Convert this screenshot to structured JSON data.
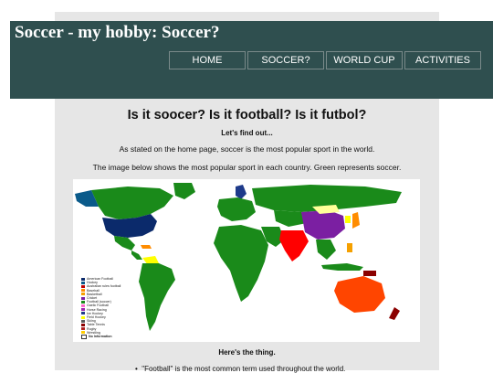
{
  "header": {
    "title": "Soccer - my hobby: Soccer?",
    "nav": [
      "HOME",
      "SOCCER?",
      "WORLD CUP",
      "ACTIVITIES"
    ]
  },
  "main": {
    "heading": "Is it soocer? Is it football? Is it futbol?",
    "subheading": "Let's find out...",
    "paragraph1": "As stated on the home page, soccer is the most popular sport in the world.",
    "paragraph2": "The image below shows the most popular sport in each country. Green represents soccer.",
    "subheading2": "Here's the thing.",
    "bullet1": "\"Football\" is the most common term used throughout the world."
  },
  "map": {
    "legend": [
      {
        "label": "American Football",
        "color": "#0b2a6b"
      },
      {
        "label": "Hockey",
        "color": "#0a5a8a"
      },
      {
        "label": "Australian rules football",
        "color": "#c00000"
      },
      {
        "label": "Baseball",
        "color": "#ff8c00"
      },
      {
        "label": "Basketball",
        "color": "#f5a000"
      },
      {
        "label": "Cricket",
        "color": "#7b1fa2"
      },
      {
        "label": "Football (soccer)",
        "color": "#1a8a1a"
      },
      {
        "label": "Gaelic Football",
        "color": "#ff66cc"
      },
      {
        "label": "Horse Racing",
        "color": "#9c27b0"
      },
      {
        "label": "Ice Hockey",
        "color": "#1e3a8a"
      },
      {
        "label": "Field Hockey",
        "color": "#ffff00"
      },
      {
        "label": "Skiing",
        "color": "#5a5a5a"
      },
      {
        "label": "Table Tennis",
        "color": "#8b0000"
      },
      {
        "label": "Rugby",
        "color": "#b22222"
      },
      {
        "label": "Wrestling",
        "color": "#ffcc00"
      },
      {
        "label": "No Information",
        "color": "#ffffff"
      }
    ]
  }
}
